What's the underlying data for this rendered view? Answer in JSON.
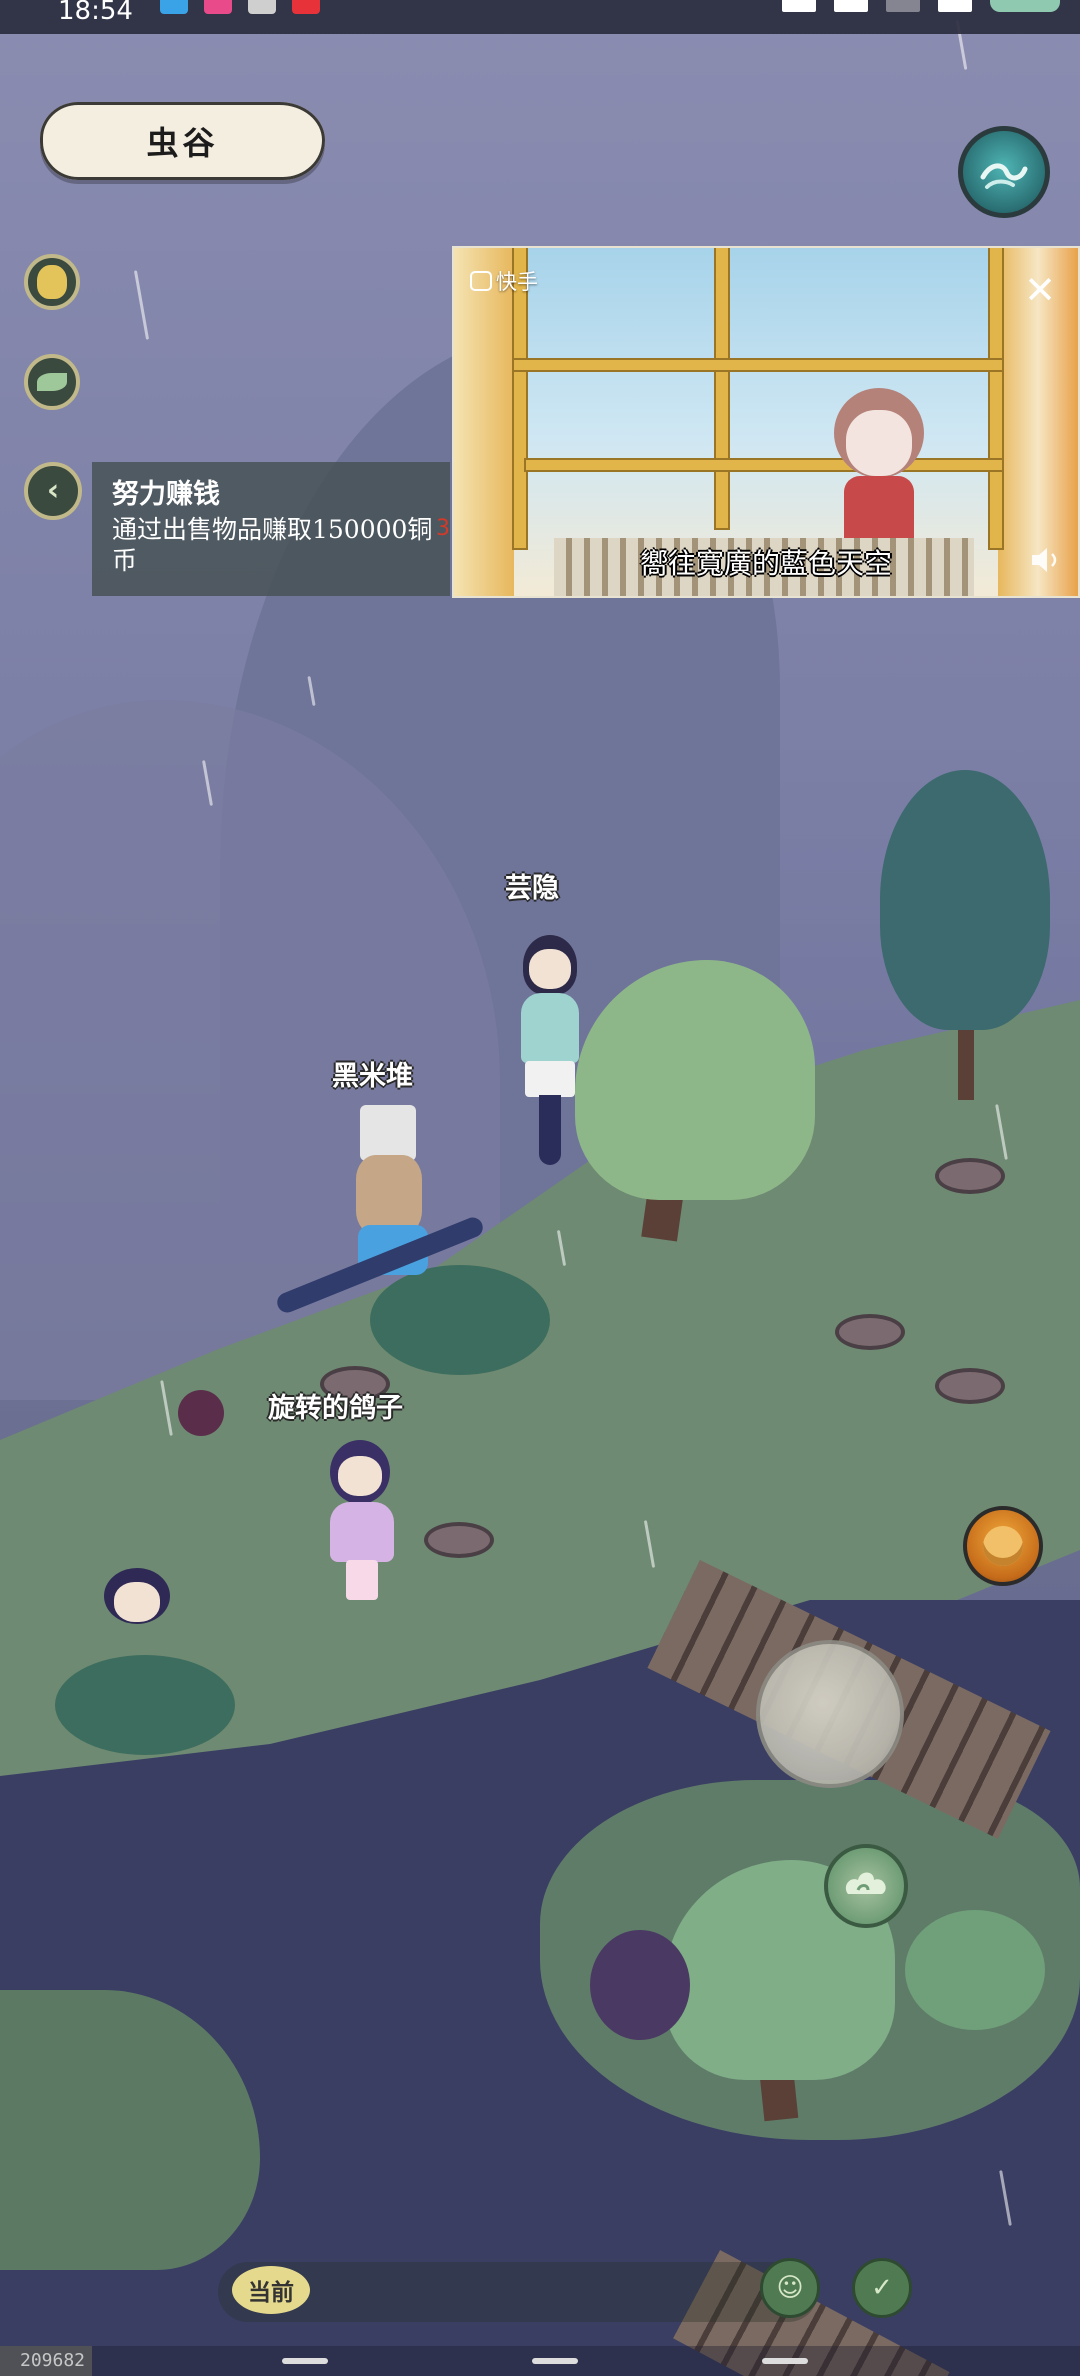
{
  "status_bar": {
    "time": "18:54"
  },
  "location": {
    "name": "虫谷"
  },
  "quest": {
    "title": "努力赚钱",
    "description": "通过出售物品赚取150000铜币",
    "count": "3"
  },
  "video_pip": {
    "brand": "快手",
    "caption": "嚮往寬廣的藍色天空",
    "close_icon": "close-icon",
    "sound_icon": "speaker-icon"
  },
  "characters": {
    "name_1": "芸隐",
    "name_2": "黑米堆",
    "name_3": "旋转的鸽子"
  },
  "bottom": {
    "current_label": "当前",
    "uid": "209682"
  },
  "colors": {
    "quest_count": "#d13a2a",
    "pip_frame": "#e2b54a",
    "current_button": "#e4d98c"
  }
}
